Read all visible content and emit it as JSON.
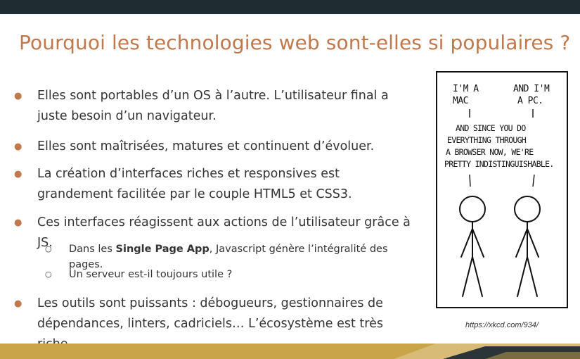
{
  "slide": {
    "title": "Pourquoi les technologies web sont-elles si populaires ?",
    "bullets": [
      {
        "marker": "●",
        "text": "Elles sont portables d’un OS à l’autre. L’utilisateur final a juste besoin d’un navigateur."
      },
      {
        "marker": "●",
        "text": "Elles sont maîtrisées, matures et continuent d’évoluer."
      },
      {
        "marker": "●",
        "text": "La création d’interfaces riches et responsives est grandement facilitée par le couple HTML5 et CSS3."
      },
      {
        "marker": "●",
        "text": "Ces interfaces réagissent aux actions de l’utilisateur grâce à JS."
      },
      {
        "marker": "●",
        "text": "Les outils sont puissants : débogueurs, gestionnaires de dépendances, linters, cadriciels… L’écosystème est très riche."
      }
    ],
    "sub_bullets": [
      {
        "marker": "○",
        "prefix": "Dans les ",
        "bold": "Single Page App",
        "suffix": ", Javascript génère l’intégralité des pages."
      },
      {
        "marker": "○",
        "text": "Un serveur est-il toujours utile ?"
      }
    ]
  },
  "comic": {
    "left_speech": [
      "I'M A",
      "MAC"
    ],
    "right_speech": [
      "AND I'M",
      "A PC."
    ],
    "shared_speech": [
      "AND SINCE YOU DO",
      "EVERYTHING THROUGH",
      "A BROWSER NOW, WE'RE",
      "PRETTY INDISTINGUISHABLE."
    ],
    "caption": "https://xkcd.com/934/"
  },
  "colors": {
    "accent": "#c0784d",
    "top_bar": "#1f2d33",
    "bottom_gold": "#c9a449",
    "bottom_dark": "#2a3439",
    "text": "#333333"
  }
}
